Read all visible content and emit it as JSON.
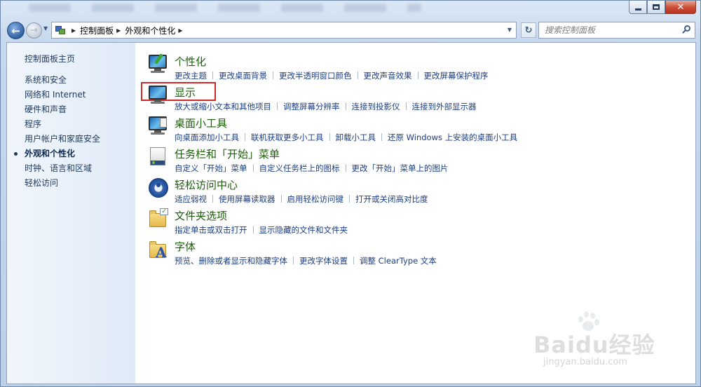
{
  "window": {
    "caption": {
      "minimize": "",
      "maximize": "",
      "close": "✕"
    }
  },
  "nav": {
    "back_icon": "back-arrow-icon",
    "forward_icon": "forward-arrow-icon",
    "breadcrumbs": [
      "控制面板",
      "外观和个性化"
    ],
    "refresh_glyph": "↻",
    "search_placeholder": "搜索控制面板"
  },
  "sidebar": {
    "home": "控制面板主页",
    "items": [
      {
        "label": "系统和安全",
        "current": false
      },
      {
        "label": "网络和 Internet",
        "current": false
      },
      {
        "label": "硬件和声音",
        "current": false
      },
      {
        "label": "程序",
        "current": false
      },
      {
        "label": "用户帐户和家庭安全",
        "current": false
      },
      {
        "label": "外观和个性化",
        "current": true
      },
      {
        "label": "时钟、语言和区域",
        "current": false
      },
      {
        "label": "轻松访问",
        "current": false
      }
    ]
  },
  "categories": [
    {
      "title": "个性化",
      "icon": "personalization-icon",
      "links": [
        "更改主题",
        "更改桌面背景",
        "更改半透明窗口颜色",
        "更改声音效果",
        "更改屏幕保护程序"
      ]
    },
    {
      "title": "显示",
      "icon": "display-icon",
      "highlighted": true,
      "links": [
        "放大或缩小文本和其他项目",
        "调整屏幕分辨率",
        "连接到投影仪",
        "连接到外部显示器"
      ]
    },
    {
      "title": "桌面小工具",
      "icon": "desktop-gadgets-icon",
      "links": [
        "向桌面添加小工具",
        "联机获取更多小工具",
        "卸载小工具",
        "还原 Windows 上安装的桌面小工具"
      ]
    },
    {
      "title": "任务栏和「开始」菜单",
      "icon": "taskbar-icon",
      "links": [
        "自定义「开始」菜单",
        "自定义任务栏上的图标",
        "更改「开始」菜单上的图片"
      ]
    },
    {
      "title": "轻松访问中心",
      "icon": "ease-of-access-icon",
      "links": [
        "适应弱视",
        "使用屏幕读取器",
        "启用轻松访问键",
        "打开或关闭高对比度"
      ]
    },
    {
      "title": "文件夹选项",
      "icon": "folder-options-icon",
      "links": [
        "指定单击或双击打开",
        "显示隐藏的文件和文件夹"
      ]
    },
    {
      "title": "字体",
      "icon": "fonts-icon",
      "links": [
        "预览、删除或者显示和隐藏字体",
        "更改字体设置",
        "调整 ClearType 文本"
      ]
    }
  ],
  "watermark": {
    "brand": "Baidu经验",
    "url": "jingyan.baidu.com"
  },
  "colors": {
    "category_title": "#1c5e0a",
    "link": "#1c3e82",
    "highlight": "#d02a2a",
    "sidebar_bg": "#e6eef8"
  }
}
